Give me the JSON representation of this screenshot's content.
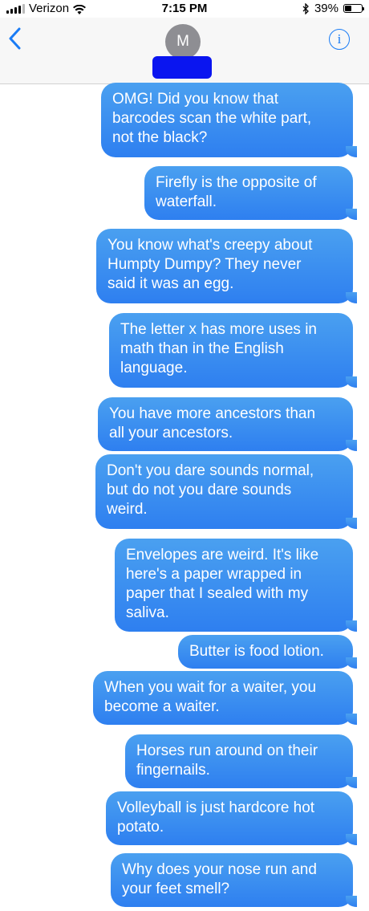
{
  "status_bar": {
    "carrier": "Verizon",
    "time": "7:15 PM",
    "battery_percent": "39%",
    "battery_level": 0.39,
    "icons": [
      "signal-icon",
      "wifi-icon",
      "bluetooth-icon",
      "battery-icon"
    ]
  },
  "header": {
    "back_icon": "chevron-left-icon",
    "avatar_initial": "M",
    "info_icon": "info-icon"
  },
  "colors": {
    "accent": "#1a7cf5",
    "bubble_top": "#4aa0f0",
    "bubble_bottom": "#2e7ff0",
    "redaction": "#0a15f0"
  },
  "messages": [
    {
      "text": "OMG! Did you know that\nbarcodes scan the white part,\nnot the black?"
    },
    {
      "text": "Firefly is the opposite of\nwaterfall."
    },
    {
      "text": "You know what's creepy about\nHumpty Dumpy? They never\nsaid it was an egg."
    },
    {
      "text": "The letter x has more uses in\nmath than in the English\nlanguage."
    },
    {
      "text": "You have more ancestors than\nall your ancestors."
    },
    {
      "text": "Don't you dare sounds normal,\nbut do not you dare sounds\nweird."
    },
    {
      "text": "Envelopes are weird. It's like\nhere's a paper wrapped in\npaper that I sealed with my\nsaliva."
    },
    {
      "text": "Butter is food lotion."
    },
    {
      "text": "When you wait for a waiter, you\nbecome a waiter."
    },
    {
      "text": "Horses run around on their\nfingernails."
    },
    {
      "text": "Volleyball is just hardcore hot\npotato."
    },
    {
      "text": "Why does your nose run and\nyour feet smell?"
    }
  ]
}
